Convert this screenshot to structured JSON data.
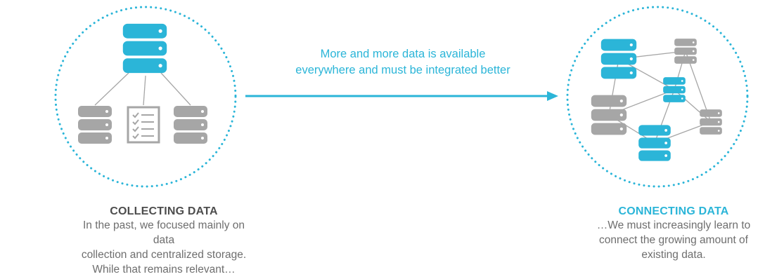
{
  "colors": {
    "accent": "#2bb5d8",
    "gray": "#a6a6a6",
    "text_gray": "#6e6e6e",
    "title_gray": "#4d4d4d"
  },
  "arrow": {
    "line1": "More and more data is available",
    "line2": "everywhere and must be integrated better"
  },
  "left": {
    "title": "COLLECTING DATA",
    "line1": "In the past, we focused mainly on data",
    "line2": "collection and centralized storage.",
    "line3": "While that remains relevant…",
    "icons": [
      "database-icon",
      "database-icon",
      "checklist-document-icon",
      "database-icon"
    ]
  },
  "right": {
    "title": "CONNECTING DATA",
    "line1": "…We must increasingly learn to",
    "line2": "connect the growing amount of",
    "line3": "existing data.",
    "icons": [
      "database-icon",
      "database-icon",
      "database-icon",
      "database-icon",
      "database-icon",
      "database-icon"
    ]
  }
}
